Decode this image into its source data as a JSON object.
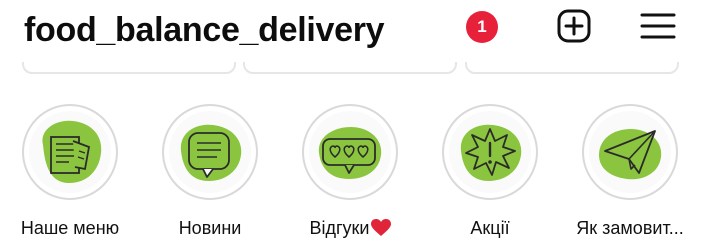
{
  "profile": {
    "username": "food_balance_delivery",
    "notification_count": "1"
  },
  "header": {
    "new_post_icon": "plus-square-icon",
    "menu_icon": "hamburger-menu-icon"
  },
  "highlights": [
    {
      "label": "Наше меню",
      "icon": "menu-document-icon"
    },
    {
      "label": "Новини",
      "icon": "chat-bubble-icon"
    },
    {
      "label": "Відгуки",
      "icon": "hearts-speech-bubble-icon",
      "suffix_icon": "red-heart-emoji"
    },
    {
      "label": "Акції",
      "icon": "exclamation-burst-icon"
    },
    {
      "label": "Як замовит...",
      "icon": "paper-plane-icon"
    }
  ],
  "colors": {
    "text": "#111111",
    "badge": "#e8213a",
    "highlight_blob": "#8bc53f",
    "highlight_ring": "#d9d9d9",
    "heart": "#e0243a"
  }
}
